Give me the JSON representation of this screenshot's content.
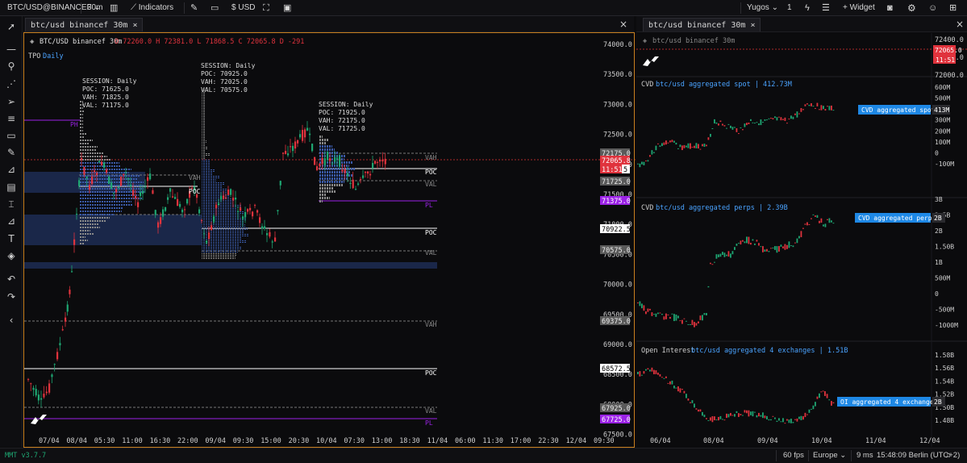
{
  "toolbar": {
    "symbol": "BTC/USD@BINANCEF",
    "timeframe": "30m",
    "indicators_label": "Indicators",
    "quote": "USD",
    "workspace": "Yugos",
    "workspace_count": "1",
    "widget_label": "Widget"
  },
  "tabs": {
    "left": "btc/usd binancef 30m",
    "right": "btc/usd binancef 30m"
  },
  "main_chart": {
    "header_symbol": "BTC/USD binancef 30m",
    "ohlc": "O 72260.0 H 72381.0 L 71868.5 C 72065.8 D -291",
    "tpo_label": "TPO",
    "tpo_period": "Daily",
    "price_axis": [
      "74000.0",
      "73500.0",
      "73000.0",
      "72500.0",
      "72000.0",
      "71500.0",
      "71000.0",
      "70500.0",
      "70000.0",
      "69500.0",
      "69000.0",
      "68500.0",
      "68000.0",
      "67500.0"
    ],
    "time_axis": [
      "07/04",
      "08/04",
      "05:30",
      "11:00",
      "16:30",
      "22:00",
      "09/04",
      "09:30",
      "15:00",
      "20:30",
      "10/04",
      "07:30",
      "13:00",
      "18:30",
      "11/04",
      "06:00",
      "11:30",
      "17:00",
      "22:30",
      "12/04",
      "09:30"
    ],
    "price_tags": {
      "vah_a": "72175.0",
      "last": "72065.8",
      "countdown": "11:51",
      "val_a": "71725.0",
      "pl_a": "71375.0",
      "poc_b": "70922.5",
      "val_b": "70575.0",
      "vah_c": "69375.0",
      "poc_c": "68572.5",
      "val_c": "67925.0",
      "pl_c": "67725.0"
    },
    "sessions": [
      {
        "title": "SESSION: Daily",
        "poc": "POC:  71625.0",
        "vah": "VAH:  71825.0",
        "val": "VAL:  71175.0"
      },
      {
        "title": "SESSION: Daily",
        "poc": "POC:  70925.0",
        "vah": "VAH:  72025.0",
        "val": "VAL:  70575.0"
      },
      {
        "title": "SESSION: Daily",
        "poc": "POC:  71925.0",
        "vah": "VAH:  72175.0",
        "val": "VAL:  71725.0"
      }
    ],
    "level_labels": {
      "vah": "VAH",
      "val": "VAL",
      "poc": "POC",
      "pl": "PL",
      "ph": "PH"
    }
  },
  "side_panel": {
    "header_symbol": "btc/usd binancef 30m",
    "price_axis": [
      "72400.0",
      "72200.0",
      "72000.0"
    ],
    "last_price": "72065.0",
    "countdown": "11:51",
    "time_axis": [
      "06/04",
      "08/04",
      "09/04",
      "10/04",
      "11/04",
      "12/04"
    ],
    "cvd_spot": {
      "title": "CVD",
      "subtitle": "btc/usd aggregated spot | 412.73M",
      "legend": "CVD aggregated spot",
      "legend_value": "413M",
      "axis": [
        "600M",
        "500M",
        "400M",
        "300M",
        "200M",
        "100M",
        "0",
        "-100M"
      ]
    },
    "cvd_perps": {
      "title": "CVD",
      "subtitle": "btc/usd aggregated perps | 2.39B",
      "legend": "CVD aggregated perps",
      "legend_value": "2B",
      "axis": [
        "3B",
        "2.5B",
        "2B",
        "1.50B",
        "1B",
        "500M",
        "0",
        "-500M",
        "-1000M"
      ]
    },
    "open_interest": {
      "title": "Open Interest",
      "subtitle": "btc/usd aggregated 4 exchanges | 1.51B",
      "legend": "OI aggregated 4 exchanges",
      "legend_value": "2B",
      "axis": [
        "1.58B",
        "1.56B",
        "1.54B",
        "1.52B",
        "1.50B",
        "1.48B"
      ]
    }
  },
  "status": {
    "version": "MMT v3.7.7",
    "fps": "60 fps",
    "region": "Europe",
    "latency": "9 ms",
    "clock": "15:48:09 Berlin (UTC+2)"
  },
  "colors": {
    "accent": "#c87f1e",
    "bull": "#1ea672",
    "bear": "#e0333d",
    "poc": "#ffffff",
    "pl": "#9b22e6",
    "panel_blue": "#1e88e5"
  }
}
